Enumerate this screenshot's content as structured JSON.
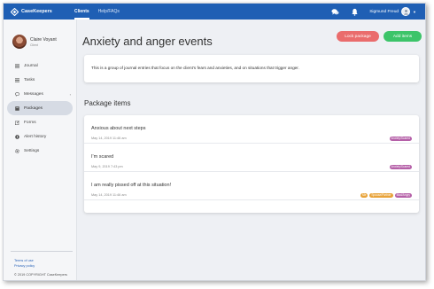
{
  "app": {
    "name": "CaseKeepers"
  },
  "nav": {
    "links": [
      {
        "label": "Clients",
        "active": true
      },
      {
        "label": "Help/FAQs",
        "active": false
      }
    ]
  },
  "user": {
    "name": "Sigmund Freud"
  },
  "icons": {
    "logo": "diamond-logo-icon",
    "messages": "chat-bubbles-icon",
    "notifications": "bell-icon",
    "avatar": "user-icon"
  },
  "client": {
    "name": "Claire Voyant",
    "role": "Client"
  },
  "sidebar": {
    "items": [
      {
        "label": "Journal",
        "icon": "list-icon"
      },
      {
        "label": "Tasks",
        "icon": "list-icon"
      },
      {
        "label": "Messages",
        "icon": "chat-icon",
        "has_arrow": true
      },
      {
        "label": "Packages",
        "icon": "package-icon",
        "active": true
      },
      {
        "label": "Forms",
        "icon": "edit-icon"
      },
      {
        "label": "Alert history",
        "icon": "alert-icon"
      },
      {
        "label": "Settings",
        "icon": "gear-icon"
      }
    ],
    "footer": {
      "terms": "Terms of use",
      "privacy": "Privacy policy",
      "copyright": "© 2019 COPYRIGHT CaseKeepers"
    }
  },
  "page": {
    "title": "Anxiety and anger events",
    "lock_button": "Lock package",
    "add_button": "Add items",
    "description": "This is a group of journal entries that focus on the client's fears and anxieties, and on situations that trigger anger.",
    "section_title": "Package items",
    "items": [
      {
        "title": "Anxious about next steps",
        "date": "May 14, 2019 11:46 am",
        "tags": [
          {
            "label": "Anxiety/Scared",
            "color": "#b560a8"
          }
        ]
      },
      {
        "title": "I'm scared",
        "date": "May 9, 2019 7:43 pm",
        "tags": [
          {
            "label": "Anxiety/Scared",
            "color": "#b560a8"
          }
        ]
      },
      {
        "title": "I am really pissed off at this situation!",
        "date": "May 14, 2019 11:46 am",
        "tags": [
          {
            "label": "Me",
            "color": "#e8a33a"
          },
          {
            "label": "Spouse/Partner",
            "color": "#e8a33a"
          },
          {
            "label": "Mad/Angry",
            "color": "#b560a8"
          }
        ]
      }
    ]
  },
  "colors": {
    "topbar": "#1f5fb4",
    "lock": "#ea6c6c",
    "add": "#3cc469",
    "tag_purple": "#b560a8",
    "tag_orange": "#e8a33a"
  }
}
